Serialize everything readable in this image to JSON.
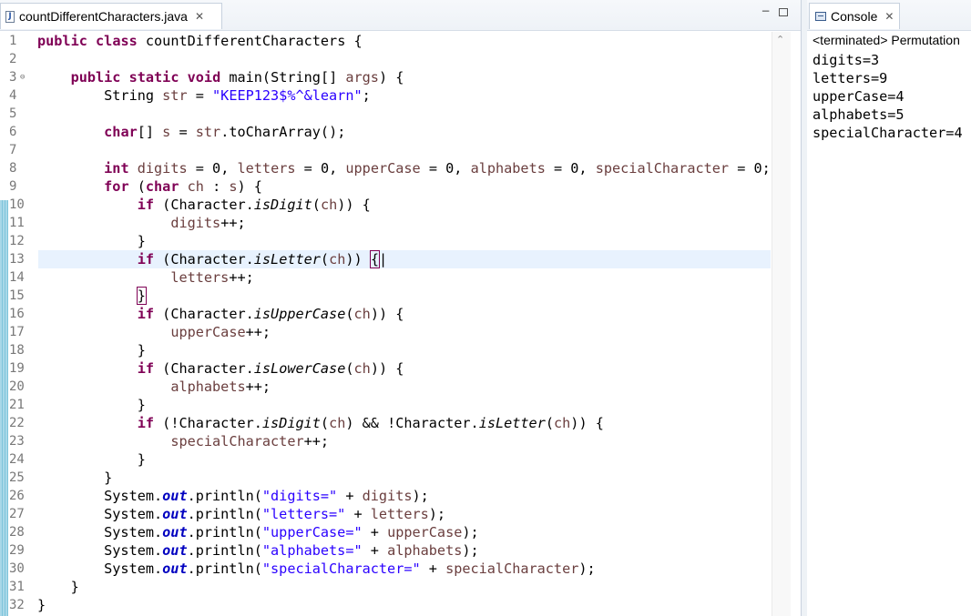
{
  "editor": {
    "tab_title": "countDifferentCharacters.java",
    "tab_close": "✕",
    "file_icon": "J",
    "minimize_glyph": "−",
    "maximize_glyph": ""
  },
  "code_lines": [
    {
      "n": "1",
      "html": "<span class=\"kw\">public</span> <span class=\"kw\">class</span> countDifferentCharacters {"
    },
    {
      "n": "2",
      "html": ""
    },
    {
      "n": "3",
      "fold": true,
      "html": "    <span class=\"kw\">public</span> <span class=\"kw\">static</span> <span class=\"kw\">void</span> main(String[] <span class=\"var\">args</span>) {"
    },
    {
      "n": "4",
      "html": "        String <span class=\"var\">str</span> = <span class=\"str\">\"KEEP123$%^&amp;learn\"</span>;"
    },
    {
      "n": "5",
      "html": ""
    },
    {
      "n": "6",
      "html": "        <span class=\"kw\">char</span>[] <span class=\"var\">s</span> = <span class=\"var\">str</span>.toCharArray();"
    },
    {
      "n": "7",
      "html": ""
    },
    {
      "n": "8",
      "html": "        <span class=\"kw\">int</span> <span class=\"var\">digits</span> = 0, <span class=\"var\">letters</span> = 0, <span class=\"var\">upperCase</span> = 0, <span class=\"var\">alphabets</span> = 0, <span class=\"var\">specialCharacter</span> = 0;"
    },
    {
      "n": "9",
      "html": "        <span class=\"kw\">for</span> (<span class=\"kw\">char</span> <span class=\"var\">ch</span> : <span class=\"var\">s</span>) {"
    },
    {
      "n": "10",
      "html": "            <span class=\"kw\">if</span> (Character.<span class=\"itl\">isDigit</span>(<span class=\"var\">ch</span>)) {"
    },
    {
      "n": "11",
      "html": "                <span class=\"var\">digits</span>++;"
    },
    {
      "n": "12",
      "html": "            }"
    },
    {
      "n": "13",
      "current": true,
      "html": "            <span class=\"kw\">if</span> (Character.<span class=\"itl\">isLetter</span>(<span class=\"var\">ch</span>)) <span class=\"cursor-box\">{</span>|"
    },
    {
      "n": "14",
      "html": "                <span class=\"var\">letters</span>++;"
    },
    {
      "n": "15",
      "html": "            <span class=\"cursor-box\">}</span>"
    },
    {
      "n": "16",
      "html": "            <span class=\"kw\">if</span> (Character.<span class=\"itl\">isUpperCase</span>(<span class=\"var\">ch</span>)) {"
    },
    {
      "n": "17",
      "html": "                <span class=\"var\">upperCase</span>++;"
    },
    {
      "n": "18",
      "html": "            }"
    },
    {
      "n": "19",
      "html": "            <span class=\"kw\">if</span> (Character.<span class=\"itl\">isLowerCase</span>(<span class=\"var\">ch</span>)) {"
    },
    {
      "n": "20",
      "html": "                <span class=\"var\">alphabets</span>++;"
    },
    {
      "n": "21",
      "html": "            }"
    },
    {
      "n": "22",
      "html": "            <span class=\"kw\">if</span> (!Character.<span class=\"itl\">isDigit</span>(<span class=\"var\">ch</span>) &amp;&amp; !Character.<span class=\"itl\">isLetter</span>(<span class=\"var\">ch</span>)) {"
    },
    {
      "n": "23",
      "html": "                <span class=\"var\">specialCharacter</span>++;"
    },
    {
      "n": "24",
      "html": "            }"
    },
    {
      "n": "25",
      "html": "        }"
    },
    {
      "n": "26",
      "html": "        System.<span class=\"fld\">out</span>.println(<span class=\"str\">\"digits=\"</span> + <span class=\"var\">digits</span>);"
    },
    {
      "n": "27",
      "html": "        System.<span class=\"fld\">out</span>.println(<span class=\"str\">\"letters=\"</span> + <span class=\"var\">letters</span>);"
    },
    {
      "n": "28",
      "html": "        System.<span class=\"fld\">out</span>.println(<span class=\"str\">\"upperCase=\"</span> + <span class=\"var\">upperCase</span>);"
    },
    {
      "n": "29",
      "html": "        System.<span class=\"fld\">out</span>.println(<span class=\"str\">\"alphabets=\"</span> + <span class=\"var\">alphabets</span>);"
    },
    {
      "n": "30",
      "html": "        System.<span class=\"fld\">out</span>.println(<span class=\"str\">\"specialCharacter=\"</span> + <span class=\"var\">specialCharacter</span>);"
    },
    {
      "n": "31",
      "html": "    }"
    },
    {
      "n": "32",
      "html": "}"
    }
  ],
  "console": {
    "tab_title": "Console",
    "tab_close": "✕",
    "status": "<terminated> Permutation",
    "output": [
      "digits=3",
      "letters=9",
      "upperCase=4",
      "alphabets=5",
      "specialCharacter=4"
    ]
  },
  "colors": {
    "keyword": "#7f0055",
    "string": "#2a00ff",
    "static_field": "#0000c0",
    "current_line": "#e8f2fe"
  }
}
